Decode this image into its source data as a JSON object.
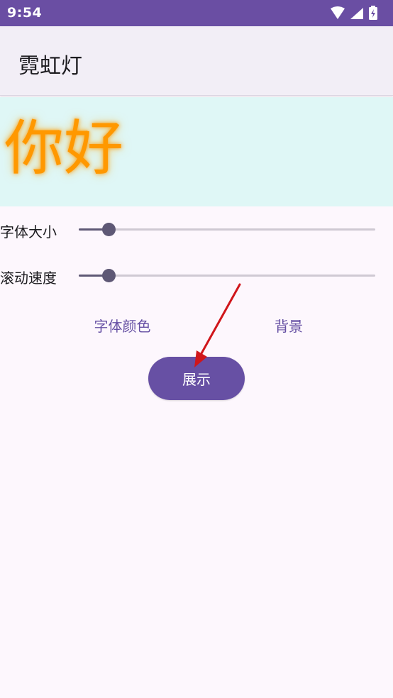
{
  "status_bar": {
    "time": "9:54",
    "icons": [
      "wifi-icon",
      "signal-icon",
      "battery-charging-icon"
    ],
    "color": "#6a4ea3"
  },
  "app_bar": {
    "title": "霓虹灯"
  },
  "preview": {
    "text": "你好",
    "text_color": "#ff9800",
    "background_color": "#dff7f6"
  },
  "controls": {
    "font_size": {
      "label": "字体大小",
      "value": 0.1
    },
    "scroll_speed": {
      "label": "滚动速度",
      "value": 0.1
    },
    "font_color_label": "字体颜色",
    "background_label": "背景",
    "show_label": "展示"
  },
  "colors": {
    "accent": "#6750a4",
    "annotation_arrow": "#d0161b"
  }
}
